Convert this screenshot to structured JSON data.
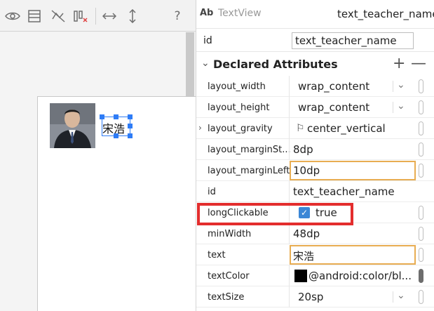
{
  "toolbar": {
    "icons": [
      "eye-icon",
      "layout-icon",
      "hide-constraints-icon",
      "clear-constraints-icon",
      "horizontal-arrows-icon",
      "vertical-arrows-icon"
    ],
    "help_label": "?"
  },
  "preview": {
    "teacher_name": "宋浩"
  },
  "header": {
    "ab_label": "Ab",
    "widget_type": "TextView",
    "widget_name": "text_teacher_name"
  },
  "id_field": {
    "label": "id",
    "value": "text_teacher_name"
  },
  "section": {
    "title": "Declared Attributes",
    "add_label": "+",
    "remove_label": "—"
  },
  "attributes": [
    {
      "name": "layout_width",
      "value": "wrap_content"
    },
    {
      "name": "layout_height",
      "value": "wrap_content"
    },
    {
      "name": "layout_gravity",
      "value": "center_vertical"
    },
    {
      "name": "layout_marginSt...",
      "value": "8dp"
    },
    {
      "name": "layout_marginLeft",
      "value": "10dp"
    },
    {
      "name": "id",
      "value": "text_teacher_name"
    },
    {
      "name": "longClickable",
      "value": "true"
    },
    {
      "name": "minWidth",
      "value": "48dp"
    },
    {
      "name": "text",
      "value": "宋浩"
    },
    {
      "name": "textColor",
      "value": "@android:color/bl..."
    },
    {
      "name": "textSize",
      "value": "20sp"
    }
  ],
  "colors": {
    "selection_blue": "#2e7cf6",
    "highlight_red": "#e32d2d",
    "edit_orange": "#e8ad52",
    "checkbox_blue": "#3b87d6",
    "text_color_swatch": "#000000"
  }
}
